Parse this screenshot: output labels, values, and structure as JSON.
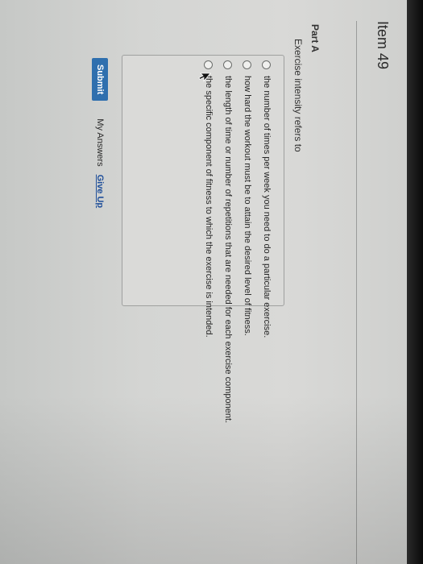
{
  "item": {
    "title": "Item 49"
  },
  "part": {
    "label": "Part A"
  },
  "question": {
    "prompt": "Exercise intensity refers to",
    "options": [
      {
        "label": "the number of times per week you need to do a particular exercise."
      },
      {
        "label": "how hard the workout must be to attain the desired level of fitness."
      },
      {
        "label": "the length of time or number of repetitions that are needed for each exercise component."
      },
      {
        "label": "the specific component of fitness to which the exercise is intended."
      }
    ]
  },
  "actions": {
    "submit_label": "Submit",
    "my_answers_label": "My Answers",
    "give_up_label": "Give Up"
  },
  "icons": {
    "radio": "radio-button-icon",
    "cursor": "mouse-pointer-icon"
  },
  "colors": {
    "submit_button": "#2f6fae",
    "link": "#1f4f9a",
    "screen_background": "#d4d5d3"
  }
}
